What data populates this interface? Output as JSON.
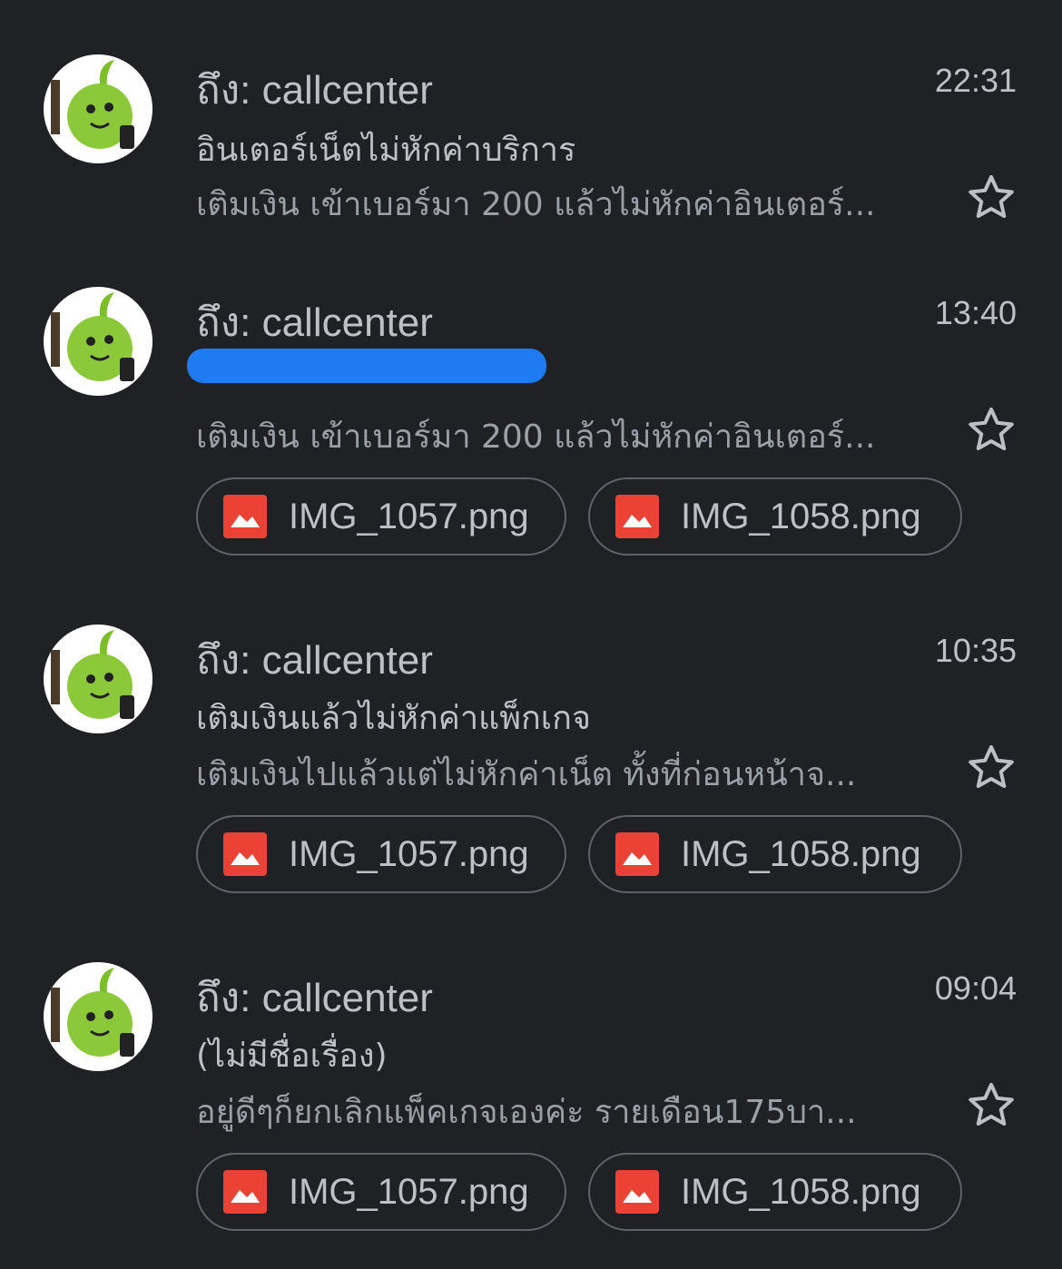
{
  "emails": [
    {
      "recipient": "ถึง: callcenter",
      "time": "22:31",
      "subject": "อินเตอร์เน็ตไม่หักค่าบริการ",
      "snippet": "เติมเงิน เข้าเบอร์มา 200 แล้วไม่หักค่าอินเตอร์...",
      "attachments": []
    },
    {
      "recipient": "ถึง: callcenter",
      "time": "13:40",
      "subject": "",
      "snippet": "เติมเงิน เข้าเบอร์มา 200 แล้วไม่หักค่าอินเตอร์...",
      "attachments": [
        "IMG_1057.png",
        "IMG_1058.png"
      ]
    },
    {
      "recipient": "ถึง: callcenter",
      "time": "10:35",
      "subject": "เติมเงินแล้วไม่หักค่าแพ็กเกจ",
      "snippet": "เติมเงินไปแล้วแต่ไม่หักค่าเน็ต ทั้งที่ก่อนหน้าจ...",
      "attachments": [
        "IMG_1057.png",
        "IMG_1058.png"
      ]
    },
    {
      "recipient": "ถึง: callcenter",
      "time": "09:04",
      "subject": "(ไม่มีชื่อเรื่อง)",
      "snippet": "อยู่ดีๆก็ยกเลิกแพ็คเกจเองค่ะ รายเดือน175บา...",
      "attachments": [
        "IMG_1057.png",
        "IMG_1058.png"
      ]
    }
  ],
  "icons": {
    "avatar": "green-mascot-avatar-icon",
    "star": "star-outline-icon",
    "attachment": "image-file-icon"
  },
  "colors": {
    "background": "#202124",
    "text_primary": "#bdc1c6",
    "text_secondary": "#9aa0a6",
    "attachment_icon": "#ea4335",
    "chip_border": "#5f6368",
    "redaction": "#1e7bf2"
  }
}
